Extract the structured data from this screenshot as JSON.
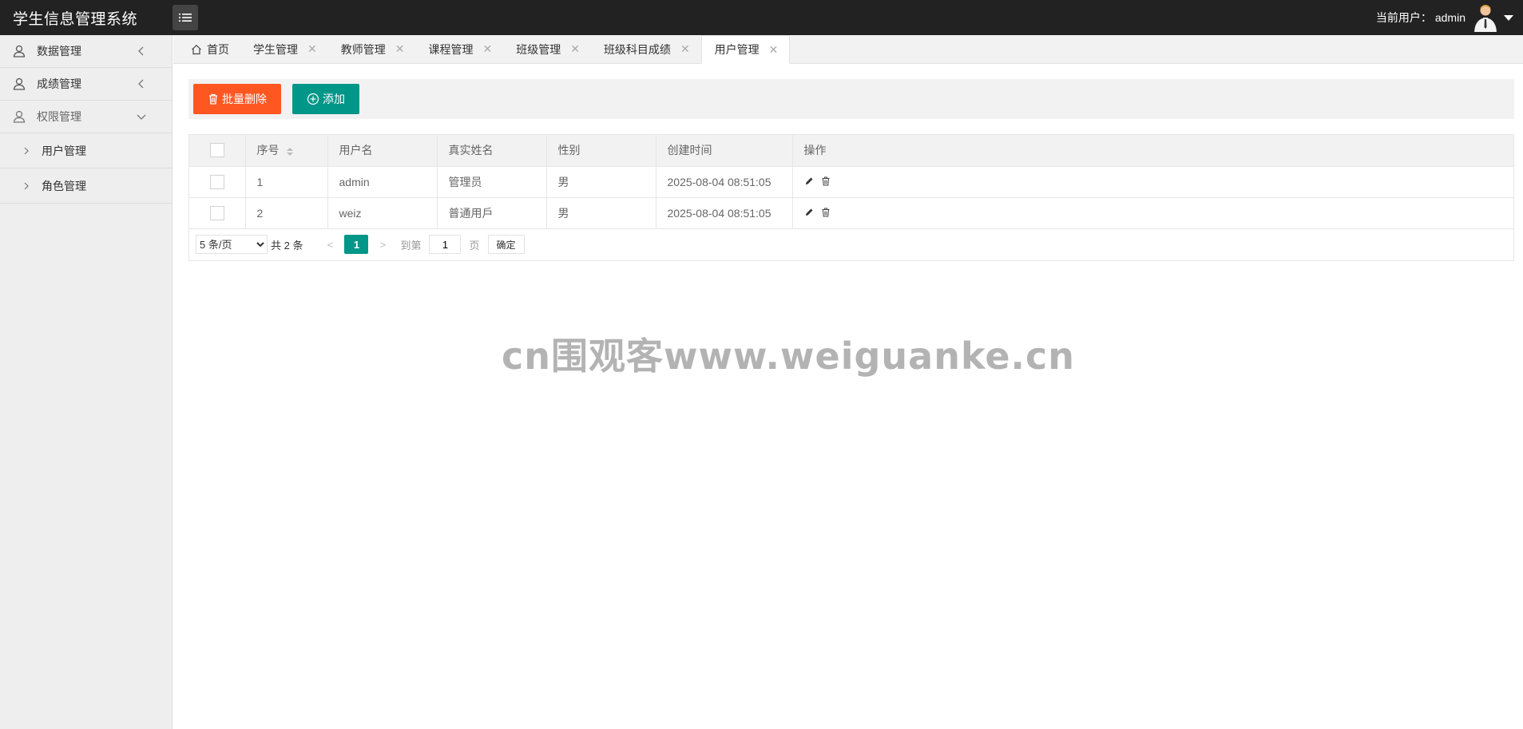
{
  "app": {
    "title": "学生信息管理系统"
  },
  "header": {
    "current_user_label": "当前用户：",
    "username": "admin"
  },
  "sidebar": {
    "items": [
      {
        "label": "数据管理"
      },
      {
        "label": "成绩管理"
      },
      {
        "label": "权限管理"
      }
    ],
    "sub_items": [
      {
        "label": "用户管理"
      },
      {
        "label": "角色管理"
      }
    ]
  },
  "tabs": [
    {
      "label": "首页"
    },
    {
      "label": "学生管理"
    },
    {
      "label": "教师管理"
    },
    {
      "label": "课程管理"
    },
    {
      "label": "班级管理"
    },
    {
      "label": "班级科目成绩"
    },
    {
      "label": "用户管理"
    }
  ],
  "toolbar": {
    "batch_delete_label": "批量删除",
    "add_label": "添加"
  },
  "table": {
    "columns": [
      "序号",
      "用户名",
      "真实姓名",
      "性别",
      "创建时间",
      "操作"
    ],
    "rows": [
      {
        "id": "1",
        "username": "admin",
        "realname": "管理员",
        "gender": "男",
        "created": "2025-08-04 08:51:05"
      },
      {
        "id": "2",
        "username": "weiz",
        "realname": "普通用戶",
        "gender": "男",
        "created": "2025-08-04 08:51:05"
      }
    ]
  },
  "pager": {
    "page_size_label": "5 条/页",
    "total_label": "共 2 条",
    "current_page": "1",
    "goto_label": "到第",
    "goto_value": "1",
    "page_unit": "页",
    "confirm_label": "确定"
  },
  "watermark": "cn围观客www.weiguanke.cn",
  "colors": {
    "header_bg": "#222222",
    "danger": "#ff5722",
    "primary": "#009688"
  }
}
